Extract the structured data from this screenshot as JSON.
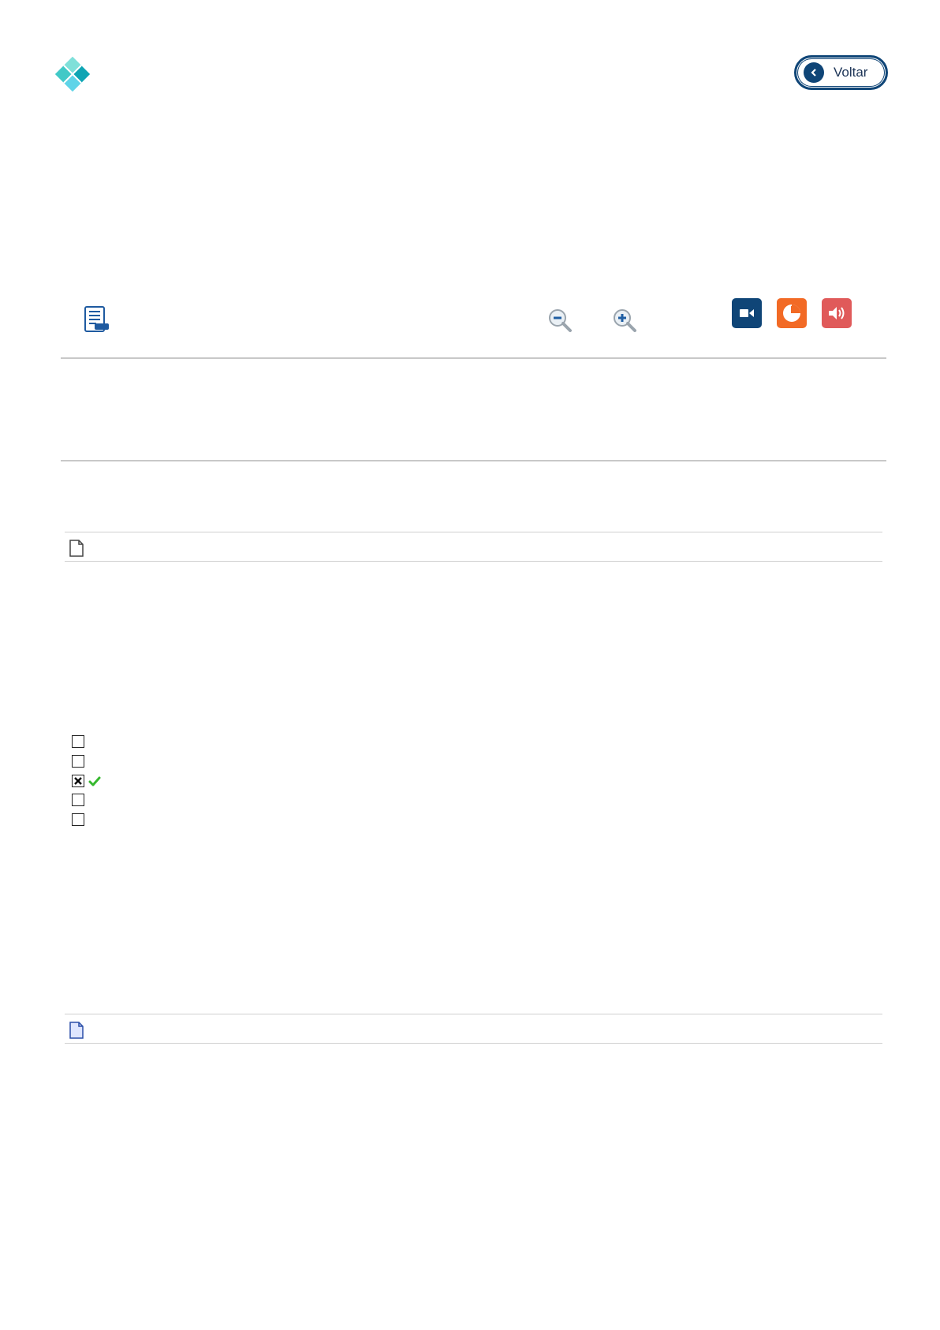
{
  "header": {
    "logo_icon": "diamond-logo-icon",
    "back_button": {
      "label": "Voltar",
      "icon": "chevron-left-icon"
    }
  },
  "toolbar": {
    "outline_icon": "document-list-icon",
    "zoom_out_icon": "zoom-out-icon",
    "zoom_in_icon": "zoom-in-icon",
    "video_button": {
      "icon": "video-camera-icon",
      "color": "#0f4577"
    },
    "chart_button": {
      "icon": "pie-chart-icon",
      "color": "#f26a25"
    },
    "audio_button": {
      "icon": "speaker-icon",
      "color": "#e05a5a"
    }
  },
  "attachments": [
    {
      "icon": "document-icon",
      "color": "#ffffff"
    },
    {
      "icon": "document-icon",
      "color": "#dfe6ff"
    }
  ],
  "options": [
    {
      "checked": false
    },
    {
      "checked": false
    },
    {
      "checked": true,
      "correct_icon": "check-mark-icon"
    },
    {
      "checked": false
    },
    {
      "checked": false
    }
  ]
}
